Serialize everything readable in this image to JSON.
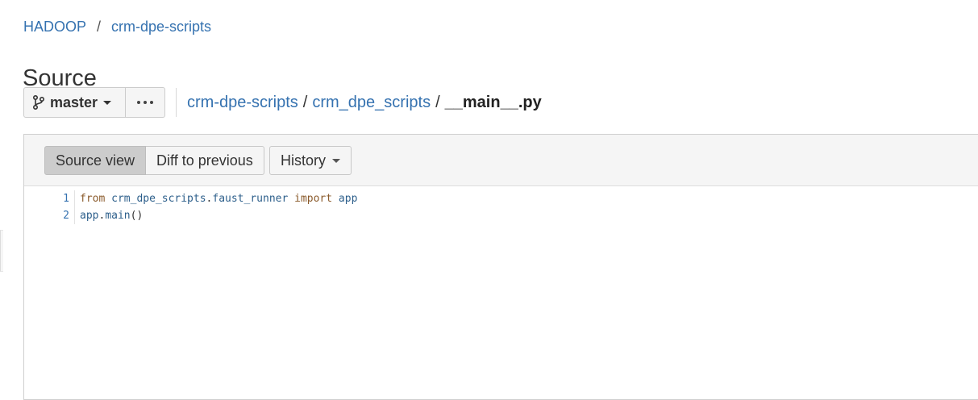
{
  "breadcrumb": {
    "project": "HADOOP",
    "separator": "/",
    "repo": "crm-dpe-scripts"
  },
  "page_title": "Source",
  "branch": {
    "label": "master",
    "icon": "branch-icon"
  },
  "more_actions_icon": "ellipsis-icon",
  "path": {
    "segments": [
      "crm-dpe-scripts",
      "crm_dpe_scripts"
    ],
    "separator": "/",
    "current_file": "__main__.py"
  },
  "view_toggle": {
    "source_view": "Source view",
    "diff_to_previous": "Diff to previous"
  },
  "history_label": "History",
  "code": {
    "lines": [
      {
        "number": "1",
        "tokens": [
          {
            "text": "from",
            "type": "kw"
          },
          {
            "text": " crm_dpe_scripts",
            "type": "id"
          },
          {
            "text": ".",
            "type": "pn"
          },
          {
            "text": "faust_runner",
            "type": "id"
          },
          {
            "text": " ",
            "type": "pn"
          },
          {
            "text": "import",
            "type": "kw"
          },
          {
            "text": " app",
            "type": "id"
          }
        ]
      },
      {
        "number": "2",
        "tokens": [
          {
            "text": "app",
            "type": "id"
          },
          {
            "text": ".",
            "type": "pn"
          },
          {
            "text": "main",
            "type": "id"
          },
          {
            "text": "()",
            "type": "pn"
          }
        ]
      }
    ]
  },
  "colors": {
    "link": "#3572b0",
    "active_toggle": "#cccccc",
    "keyword": "#8a5a2b"
  }
}
